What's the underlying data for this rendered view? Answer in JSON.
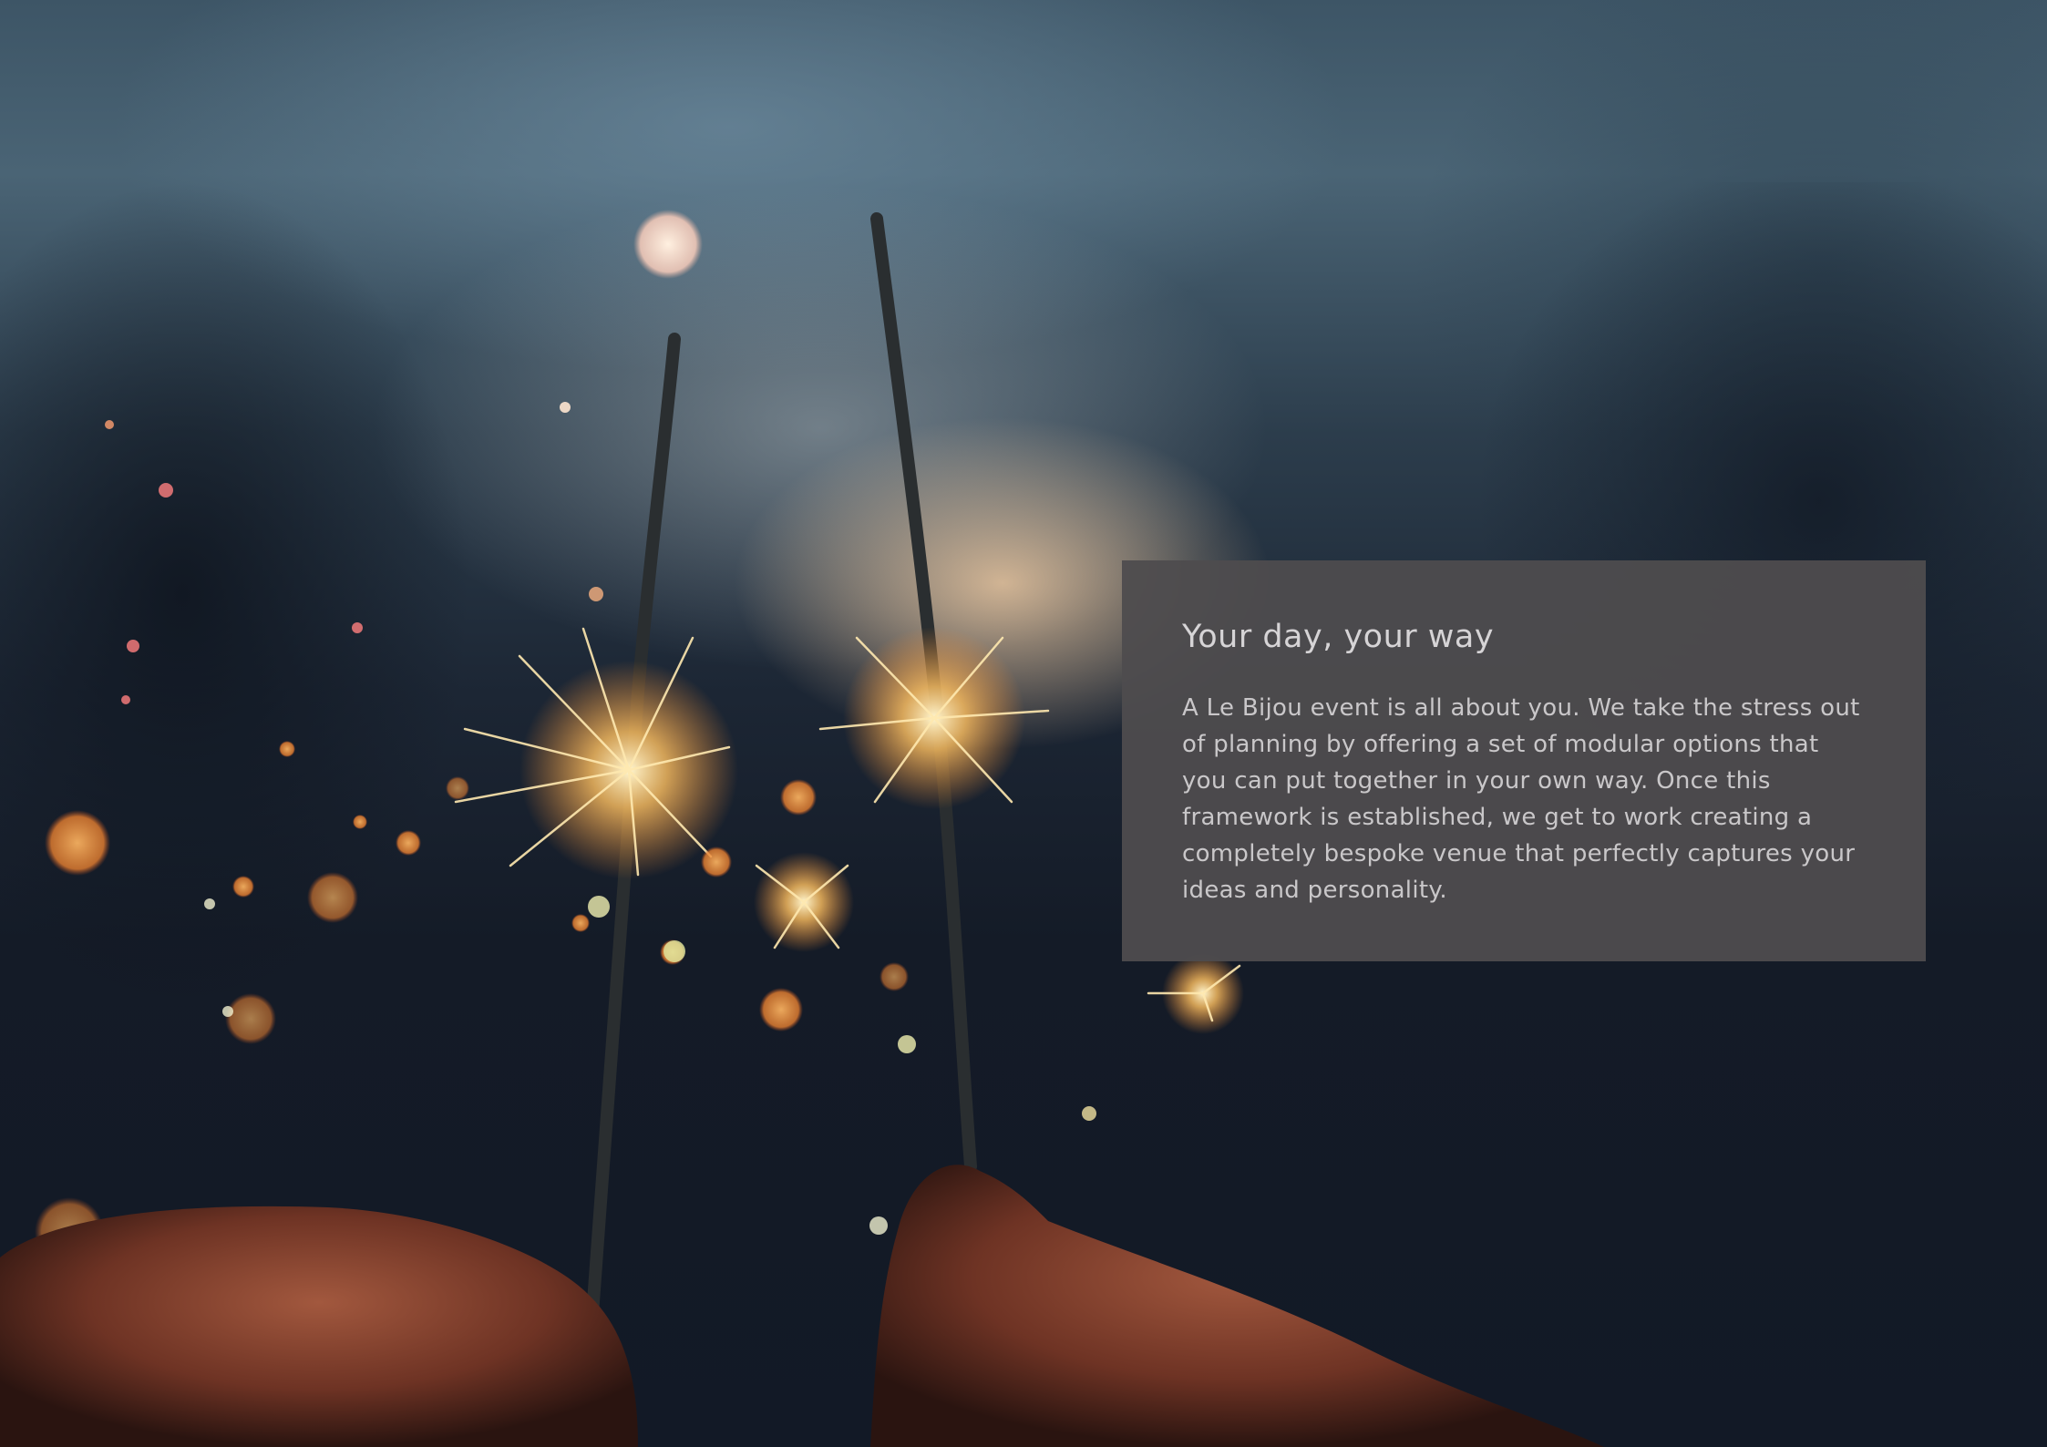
{
  "panel": {
    "title": "Your day, your way",
    "body": "A Le Bijou event is all about you. We take the stress out of planning by offering a set of modular options that you can put together in your own way. Once this framework is established, we get to work creating a completely bespoke venue that perfectly captures your ideas and personality."
  },
  "background": {
    "image_icon": "sparklers-photo-icon"
  },
  "colors": {
    "panel_bg": "#4e4c4e",
    "text": "#d6d4d6"
  }
}
